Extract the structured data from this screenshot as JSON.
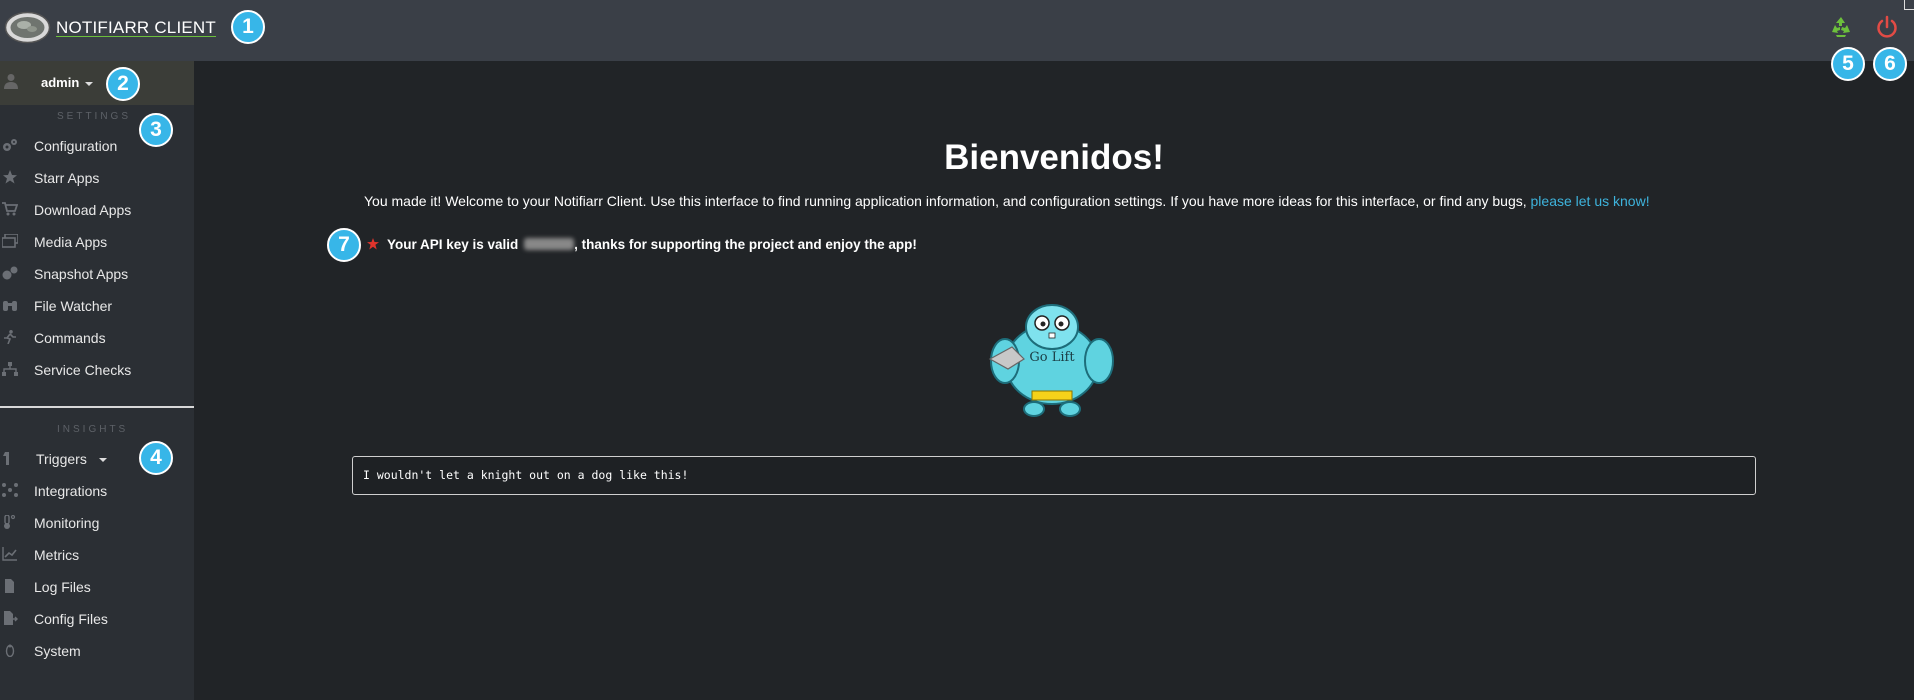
{
  "header": {
    "app_title": "NOTIFIARR CLIENT",
    "actions": [
      {
        "name": "reload-icon",
        "color": "#6cbf3c"
      },
      {
        "name": "power-icon",
        "color": "#e24b45"
      }
    ]
  },
  "sidebar": {
    "user": {
      "name": "admin",
      "icon": "user-icon"
    },
    "settings": {
      "title": "SETTINGS",
      "items": [
        {
          "label": "Configuration",
          "icon": "gears-icon"
        },
        {
          "label": "Starr Apps",
          "icon": "star-icon"
        },
        {
          "label": "Download Apps",
          "icon": "cart-icon"
        },
        {
          "label": "Media Apps",
          "icon": "media-icon"
        },
        {
          "label": "Snapshot Apps",
          "icon": "snapshot-icon"
        },
        {
          "label": "File Watcher",
          "icon": "binoculars-icon"
        },
        {
          "label": "Commands",
          "icon": "running-icon"
        },
        {
          "label": "Service Checks",
          "icon": "sitemap-icon"
        }
      ]
    },
    "insights": {
      "title": "INSIGHTS",
      "items": [
        {
          "label": "Triggers",
          "icon": "shirt-icon",
          "dropdown": true
        },
        {
          "label": "Integrations",
          "icon": "network-icon"
        },
        {
          "label": "Monitoring",
          "icon": "thermometer-icon"
        },
        {
          "label": "Metrics",
          "icon": "chart-line-icon"
        },
        {
          "label": "Log Files",
          "icon": "file-icon"
        },
        {
          "label": "Config Files",
          "icon": "file-export-icon"
        },
        {
          "label": "System",
          "icon": "linux-icon"
        }
      ]
    }
  },
  "main": {
    "welcome_title": "Bienvenidos!",
    "intro_text": "You made it! Welcome to your Notifiarr Client. Use this interface to find running application information, and configuration settings. If you have more ideas for this interface, or find any bugs,",
    "intro_link": "please let us know!",
    "api_prefix": "Your API key is valid",
    "api_suffix": ", thanks for supporting the project and enjoy the app!",
    "gopher_text": "Go Lift",
    "quote": "I wouldn't let a knight out on a dog like this!"
  },
  "badges": [
    "1",
    "2",
    "3",
    "4",
    "5",
    "6",
    "7"
  ],
  "colors": {
    "accent_link": "#3eb3dc",
    "badge": "#37b6e8",
    "header_bg": "#3a3f47",
    "sidebar_bg": "#2b2f34",
    "main_bg": "#212427"
  }
}
